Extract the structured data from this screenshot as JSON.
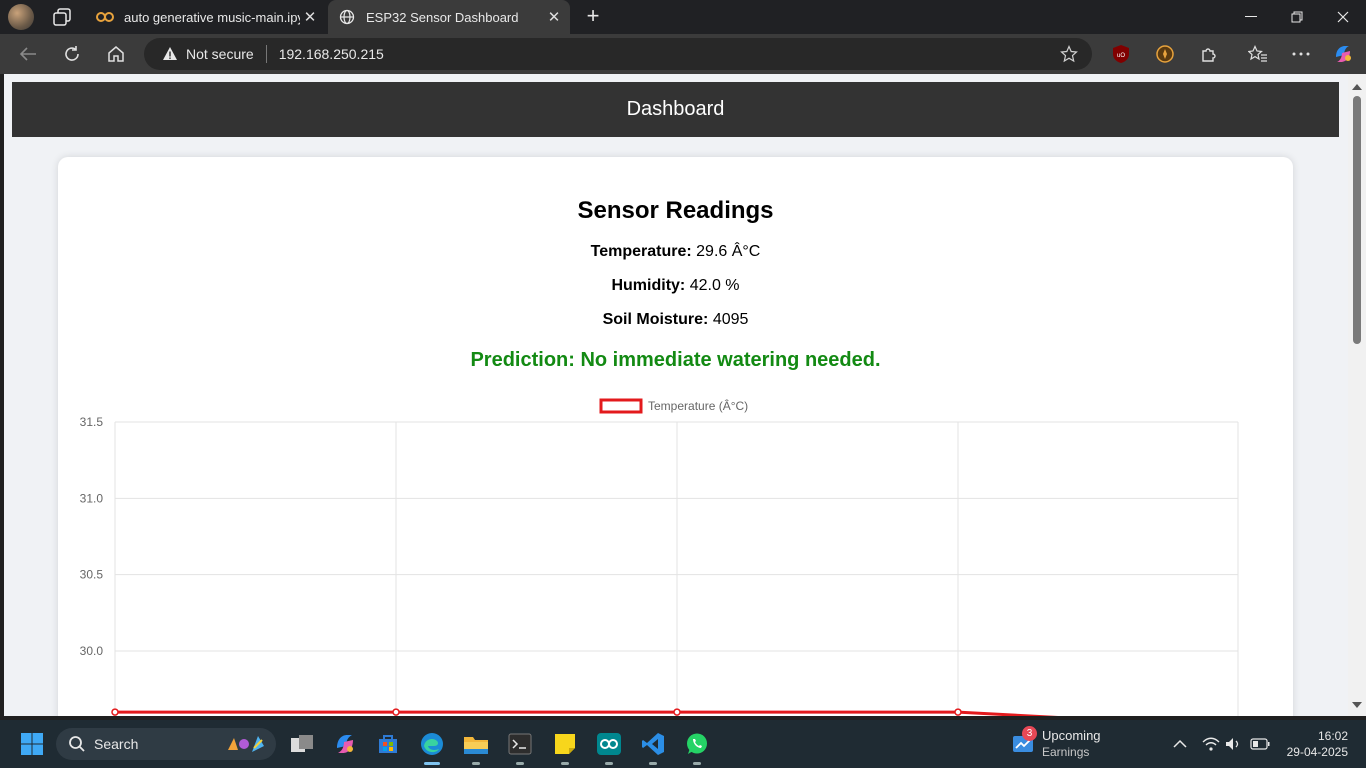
{
  "browser": {
    "tabs": [
      {
        "title": "auto generative music-main.ipynb",
        "favicon": "colab-icon"
      },
      {
        "title": "ESP32 Sensor Dashboard",
        "favicon": "globe-icon"
      }
    ],
    "security_label": "Not secure",
    "url": "192.168.250.215"
  },
  "page": {
    "header_title": "Dashboard",
    "card_title": "Sensor Readings",
    "readings": {
      "temperature": {
        "label": "Temperature:",
        "value": "29.6 Â°C"
      },
      "humidity": {
        "label": "Humidity:",
        "value": "42.0 %"
      },
      "soil": {
        "label": "Soil Moisture:",
        "value": "4095"
      }
    },
    "prediction": "Prediction: No immediate watering needed.",
    "prediction_color": "#138a13"
  },
  "chart_data": {
    "type": "line",
    "legend": [
      "Temperature (Â°C)"
    ],
    "series": [
      {
        "name": "Temperature (Â°C)",
        "color": "#e31a1c",
        "values": [
          29.6,
          29.6,
          29.6,
          29.6,
          29.5
        ]
      }
    ],
    "x": [
      0,
      1,
      2,
      3,
      4
    ],
    "yticks": [
      "31.5",
      "31.0",
      "30.5",
      "30.0"
    ],
    "ylim": [
      29.6,
      31.5
    ],
    "grid": true,
    "legend_position": "top-center"
  },
  "taskbar": {
    "search_label": "Search",
    "weather_badge": "3",
    "weather_title": "Upcoming",
    "weather_sub": "Earnings",
    "time": "16:02",
    "date": "29-04-2025"
  }
}
